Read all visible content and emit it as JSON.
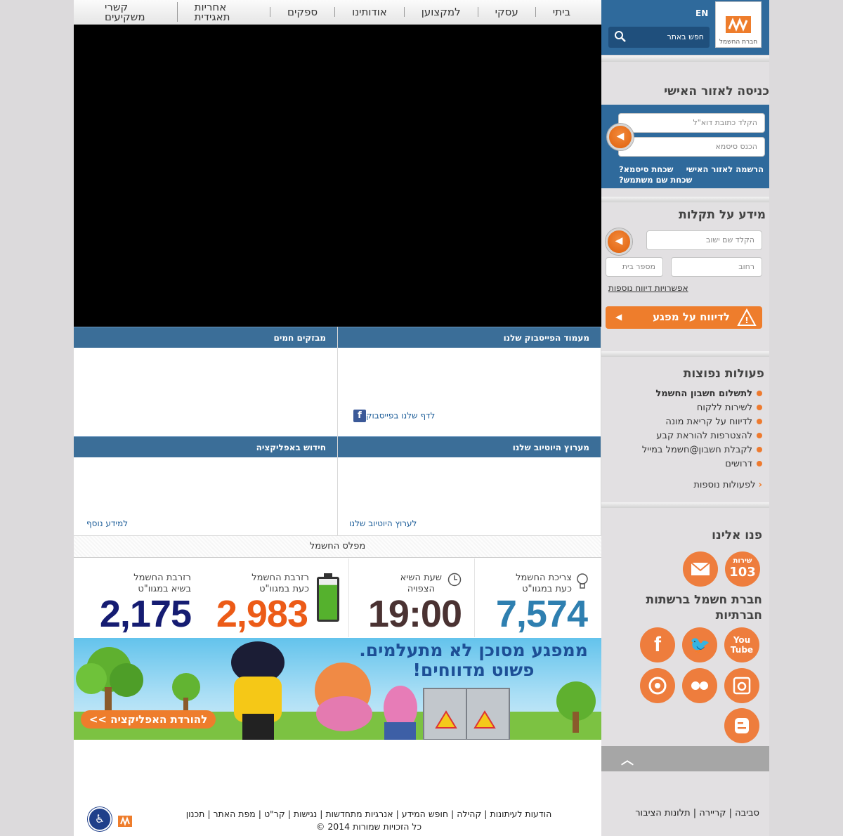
{
  "nav": {
    "items": [
      "ביתי",
      "עסקי",
      "למקצוען",
      "אודותינו",
      "ספקים",
      "אחריות תאגידית",
      "קשרי משקיעים"
    ]
  },
  "header": {
    "lang": "EN",
    "logo_text": "חברת החשמל",
    "search_placeholder": "חפש באתר"
  },
  "personal": {
    "title": "כניסה לאזור האישי",
    "email_placeholder": "הקלד כתובת דוא\"ל",
    "password_placeholder": "הכנס סיסמא",
    "register": "הרשמה לאזור האישי",
    "forgot_password": "שכחת סיסמא?",
    "forgot_user": "שכחת שם משתמש?"
  },
  "outages": {
    "title": "מידע על תקלות",
    "city_placeholder": "הקלד שם ישוב",
    "street_placeholder": "רחוב",
    "house_placeholder": "מספר בית",
    "more_options": "אפשרויות דיווח נוספות",
    "report_hazard": "לדיווח על מפגע"
  },
  "popular": {
    "title": "פעולות נפוצות",
    "items": [
      "לתשלום חשבון החשמל",
      "לשירות ללקוח",
      "לדיווח על קריאת מונה",
      "להצטרפות להוראת קבע",
      "לקבלת חשבון@חשמל במייל",
      "דרושים"
    ],
    "more": "לפעולות נוספות"
  },
  "contact": {
    "title": "פנו אלינו",
    "service_label": "שירות",
    "service_number": "103"
  },
  "social": {
    "title": "חברת חשמל ברשתות חברתיות"
  },
  "panels": {
    "facebook_title": "מעמוד הפייסבוק שלנו",
    "facebook_link": "לדף שלנו בפייסבוק",
    "hot_title": "מבזקים חמים",
    "youtube_title": "מערוץ היוטיוב שלנו",
    "youtube_link": "לערוץ היוטיוב שלנו",
    "app_title": "חידוש באפליקציה",
    "app_link": "למידע נוסף"
  },
  "power": {
    "title": "מפלס החשמל",
    "consumption_label1": "צריכת החשמל",
    "consumption_label2": "כעת במגוו\"ט",
    "consumption_value": "7,574",
    "peak_label1": "שעת השיא",
    "peak_label2": "הצפויה",
    "peak_value": "19:00",
    "reserve_now_label1": "רזרבת החשמל",
    "reserve_now_label2": "כעת במגוו\"ט",
    "reserve_now_value": "2,983",
    "reserve_peak_label1": "רזרבת החשמל",
    "reserve_peak_label2": "בשיא במגוו\"ט",
    "reserve_peak_value": "2,175",
    "battery_level": 0.85
  },
  "banner": {
    "line1": "ממפגע מסוכן לא מתעלמים.",
    "line2": "פשוט מדווחים!",
    "download": "להורדת האפליקציה >>"
  },
  "footer": {
    "links": "הודעות לעיתונות | קהילה | חופש המידע | אנרגיות מתחדשות | נגישות | קר\"ט | מפת האתר | תכנון",
    "copyright": "כל הזכויות שמורות 2014 ©",
    "side_links": "סביבה | קריירה | תלונות הציבור"
  },
  "colors": {
    "blue": "#2f6a9c",
    "orange": "#ee7d3d",
    "teal_number": "#2e7fb0",
    "dark_number": "#4a3232",
    "orange_number": "#ec5b17",
    "navy_number": "#151c72"
  }
}
